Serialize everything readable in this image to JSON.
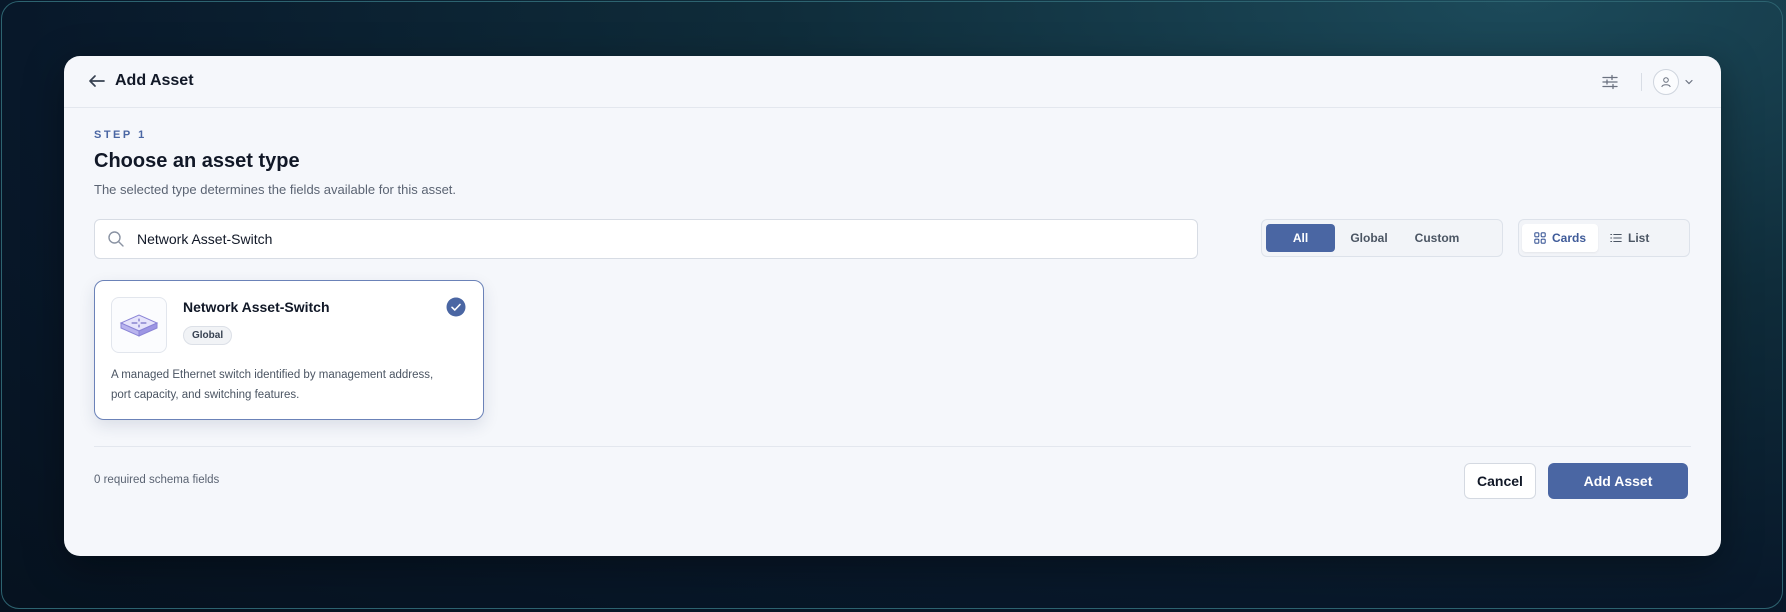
{
  "header": {
    "title": "Add Asset",
    "back_icon": "arrow-left-icon",
    "settings_icon": "sliders-icon",
    "user_icon": "user-icon",
    "menu_icon": "chevron-down-icon"
  },
  "step": {
    "label": "STEP 1",
    "title": "Choose an asset type",
    "subtitle": "The selected type determines the fields available for this asset."
  },
  "search": {
    "value": "Network Asset-Switch",
    "icon": "search-icon"
  },
  "filters": {
    "selected": "All",
    "options": [
      "All",
      "Global",
      "Custom"
    ]
  },
  "view_toggle": {
    "selected": "Cards",
    "options": [
      {
        "label": "Cards",
        "icon": "grid-icon"
      },
      {
        "label": "List",
        "icon": "list-icon"
      }
    ]
  },
  "asset_types": [
    {
      "name": "Network Asset-Switch",
      "badge": "Global",
      "description": "A managed Ethernet switch identified by management address, port capacity, and switching features.",
      "selected": true,
      "icon": "network-switch-icon"
    }
  ],
  "footer": {
    "note": "0 required schema fields",
    "cancel_label": "Cancel",
    "submit_label": "Add Asset"
  },
  "colors": {
    "accent": "#4a66a3",
    "background": "#f5f7fb",
    "text": "#111827"
  }
}
